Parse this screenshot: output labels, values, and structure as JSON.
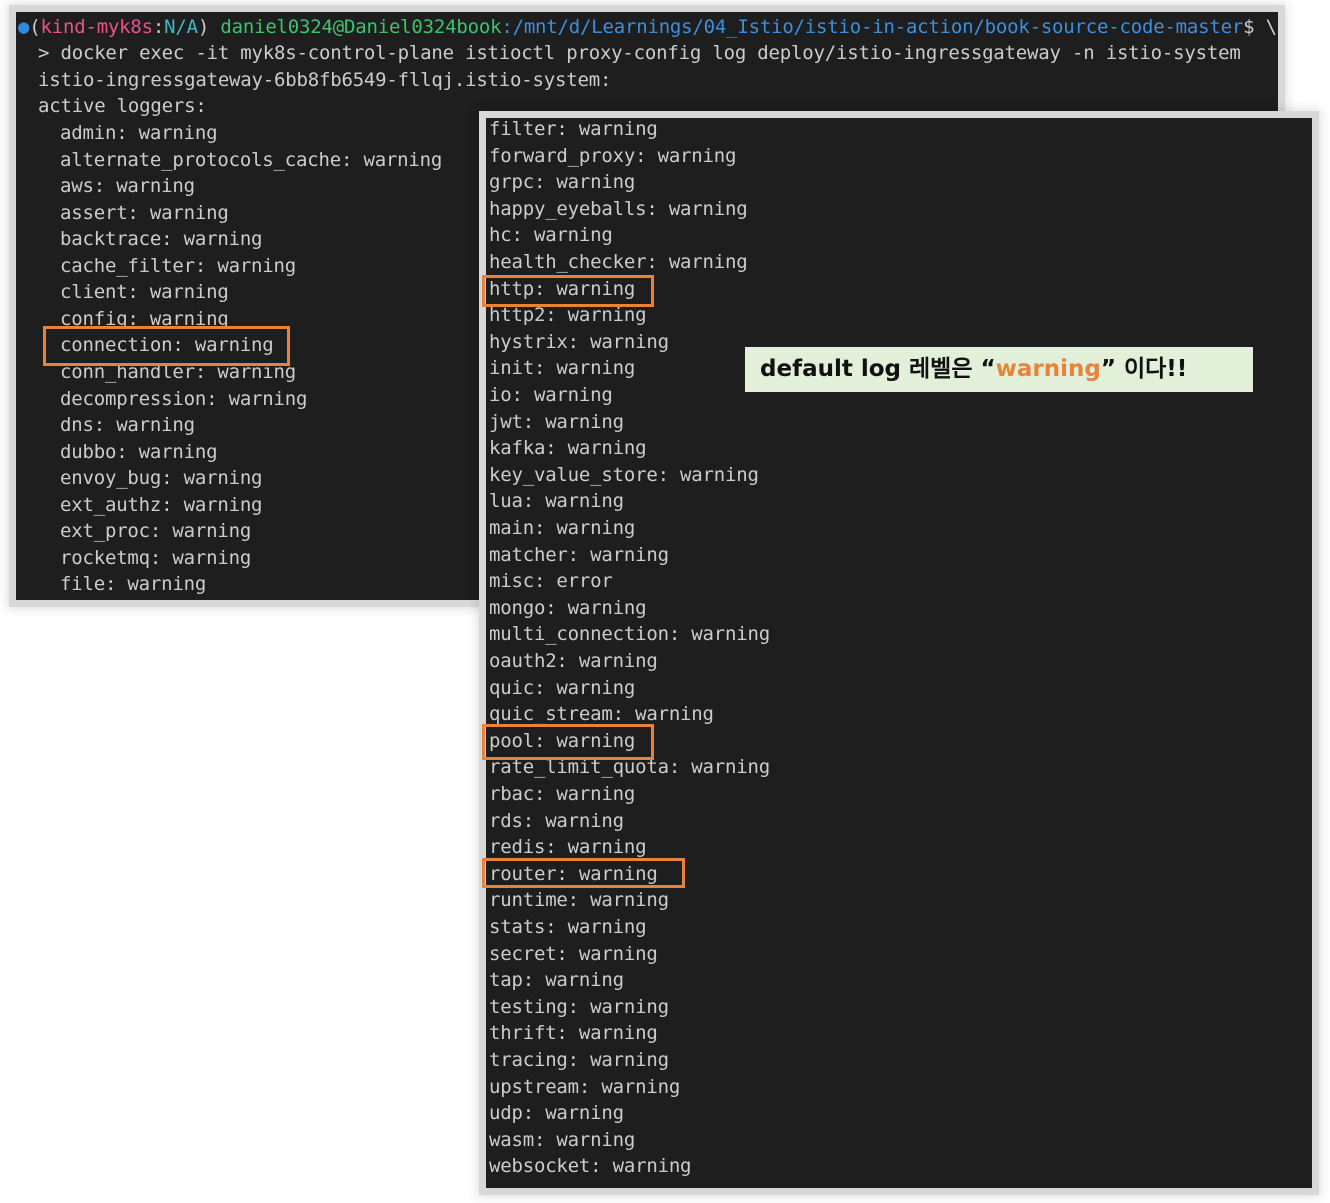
{
  "terminal_left": {
    "prompt": {
      "dot": "●",
      "open": "(",
      "kind": "kind-myk8s",
      "colon": ":",
      "ctx": "N/A",
      "close": ")",
      "user": "daniel0324@Daniel0324book",
      "path": ":/mnt/d/Learnings/04_Istio/istio-in-action/book-source-code-master",
      "tail": "$ \\"
    },
    "command": "> docker exec -it myk8s-control-plane istioctl proxy-config log deploy/istio-ingressgateway -n istio-system",
    "pod": "istio-ingressgateway-6bb8fb6549-fllqj.istio-system:",
    "header": "active loggers:",
    "loggers": [
      "admin: warning",
      "alternate_protocols_cache: warning",
      "aws: warning",
      "assert: warning",
      "backtrace: warning",
      "cache_filter: warning",
      "client: warning",
      "config: warning",
      "connection: warning",
      "conn_handler: warning",
      "decompression: warning",
      "dns: warning",
      "dubbo: warning",
      "envoy_bug: warning",
      "ext_authz: warning",
      "ext_proc: warning",
      "rocketmq: warning",
      "file: warning"
    ]
  },
  "terminal_right": {
    "loggers": [
      "filter: warning",
      "forward_proxy: warning",
      "grpc: warning",
      "happy_eyeballs: warning",
      "hc: warning",
      "health_checker: warning",
      "http: warning",
      "http2: warning",
      "hystrix: warning",
      "init: warning",
      "io: warning",
      "jwt: warning",
      "kafka: warning",
      "key_value_store: warning",
      "lua: warning",
      "main: warning",
      "matcher: warning",
      "misc: error",
      "mongo: warning",
      "multi_connection: warning",
      "oauth2: warning",
      "quic: warning",
      "quic_stream: warning",
      "pool: warning",
      "rate_limit_quota: warning",
      "rbac: warning",
      "rds: warning",
      "redis: warning",
      "router: warning",
      "runtime: warning",
      "stats: warning",
      "secret: warning",
      "tap: warning",
      "testing: warning",
      "thrift: warning",
      "tracing: warning",
      "upstream: warning",
      "udp: warning",
      "wasm: warning",
      "websocket: warning"
    ]
  },
  "callout": {
    "prefix": "default log 레벨은 “",
    "accent": "warning",
    "suffix": "” 이다!!"
  },
  "colors": {
    "terminal_bg": "#1e1e1e",
    "terminal_text": "#cccccc",
    "highlight_box": "#e8833a",
    "callout_bg": "#e2efd9",
    "callout_accent": "#e8833a"
  }
}
